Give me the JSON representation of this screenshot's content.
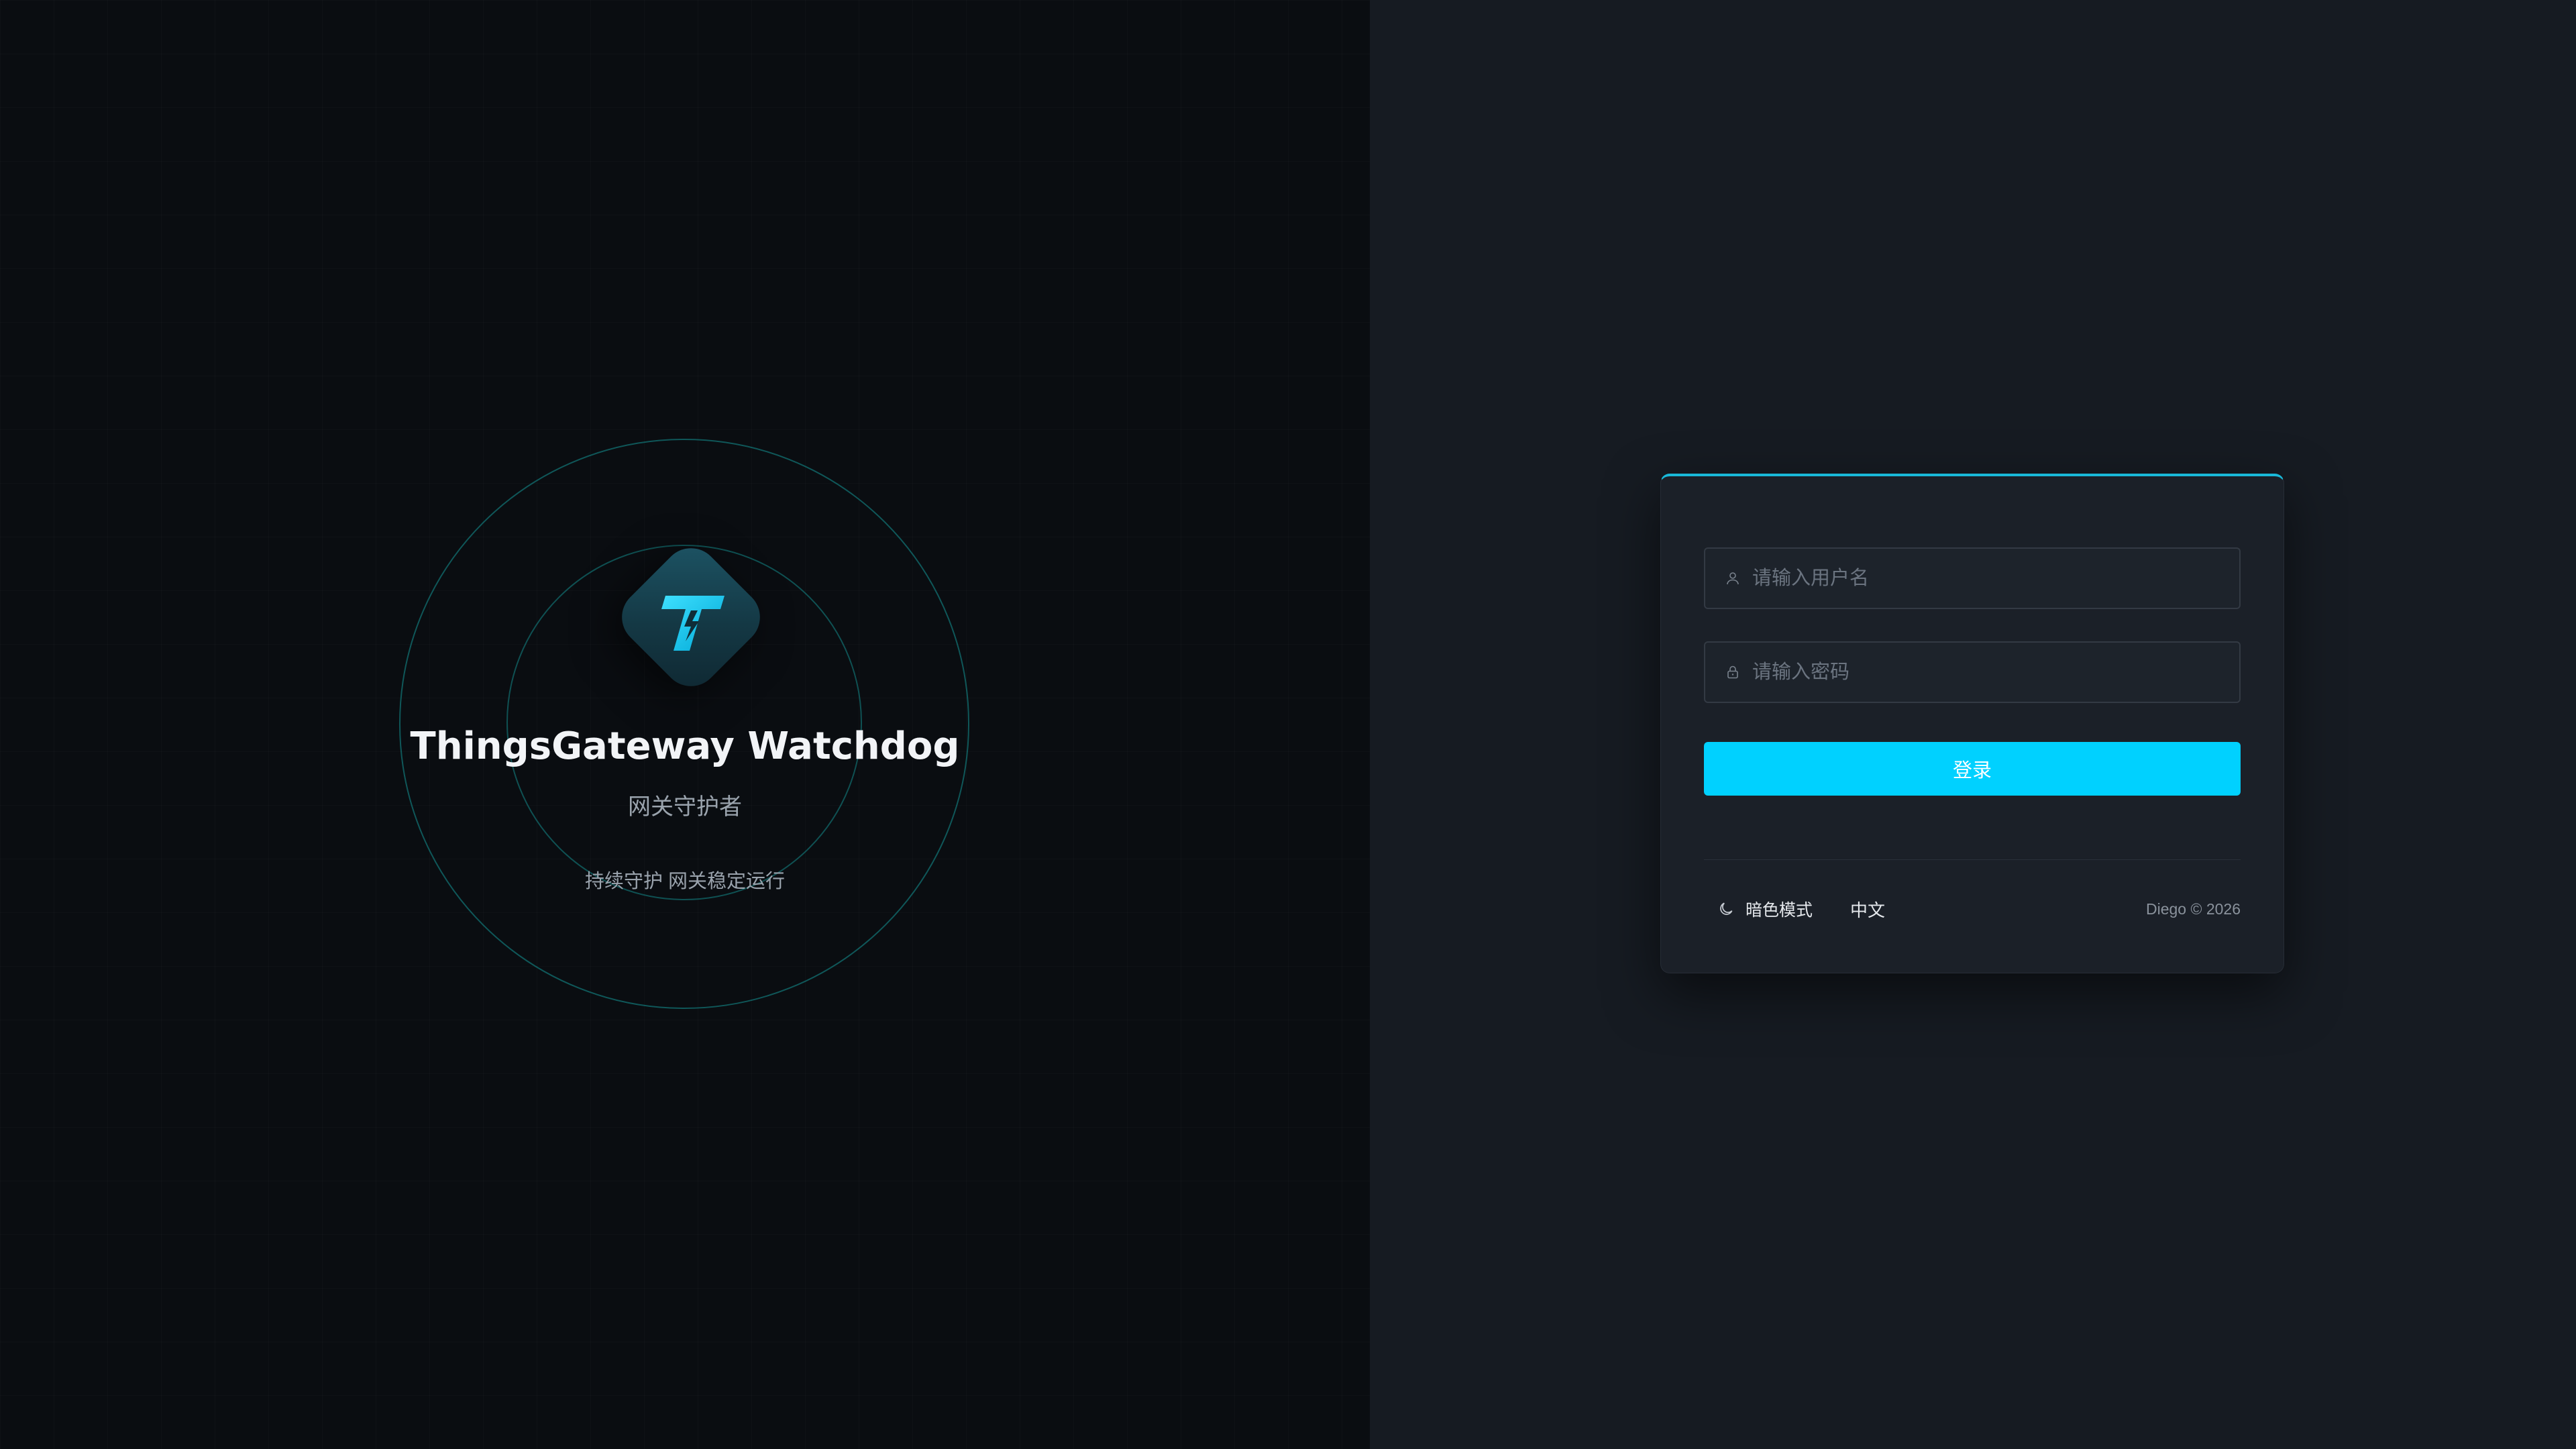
{
  "brand": {
    "title": "ThingsGateway Watchdog",
    "subtitle": "网关守护者",
    "tagline": "持续守护 网关稳定运行",
    "logo_letter": "T",
    "logo_icon": "lightning-t-logo-icon",
    "accent_color": "#00d1ff",
    "ring_color": "#149696"
  },
  "login": {
    "username": {
      "placeholder": "请输入用户名",
      "icon": "user-icon",
      "value": ""
    },
    "password": {
      "placeholder": "请输入密码",
      "icon": "lock-icon",
      "value": ""
    },
    "submit_label": "登录",
    "theme_toggle": {
      "label": "暗色模式",
      "icon": "moon-icon"
    },
    "language": "中文",
    "copyright": "Diego © 2026"
  }
}
